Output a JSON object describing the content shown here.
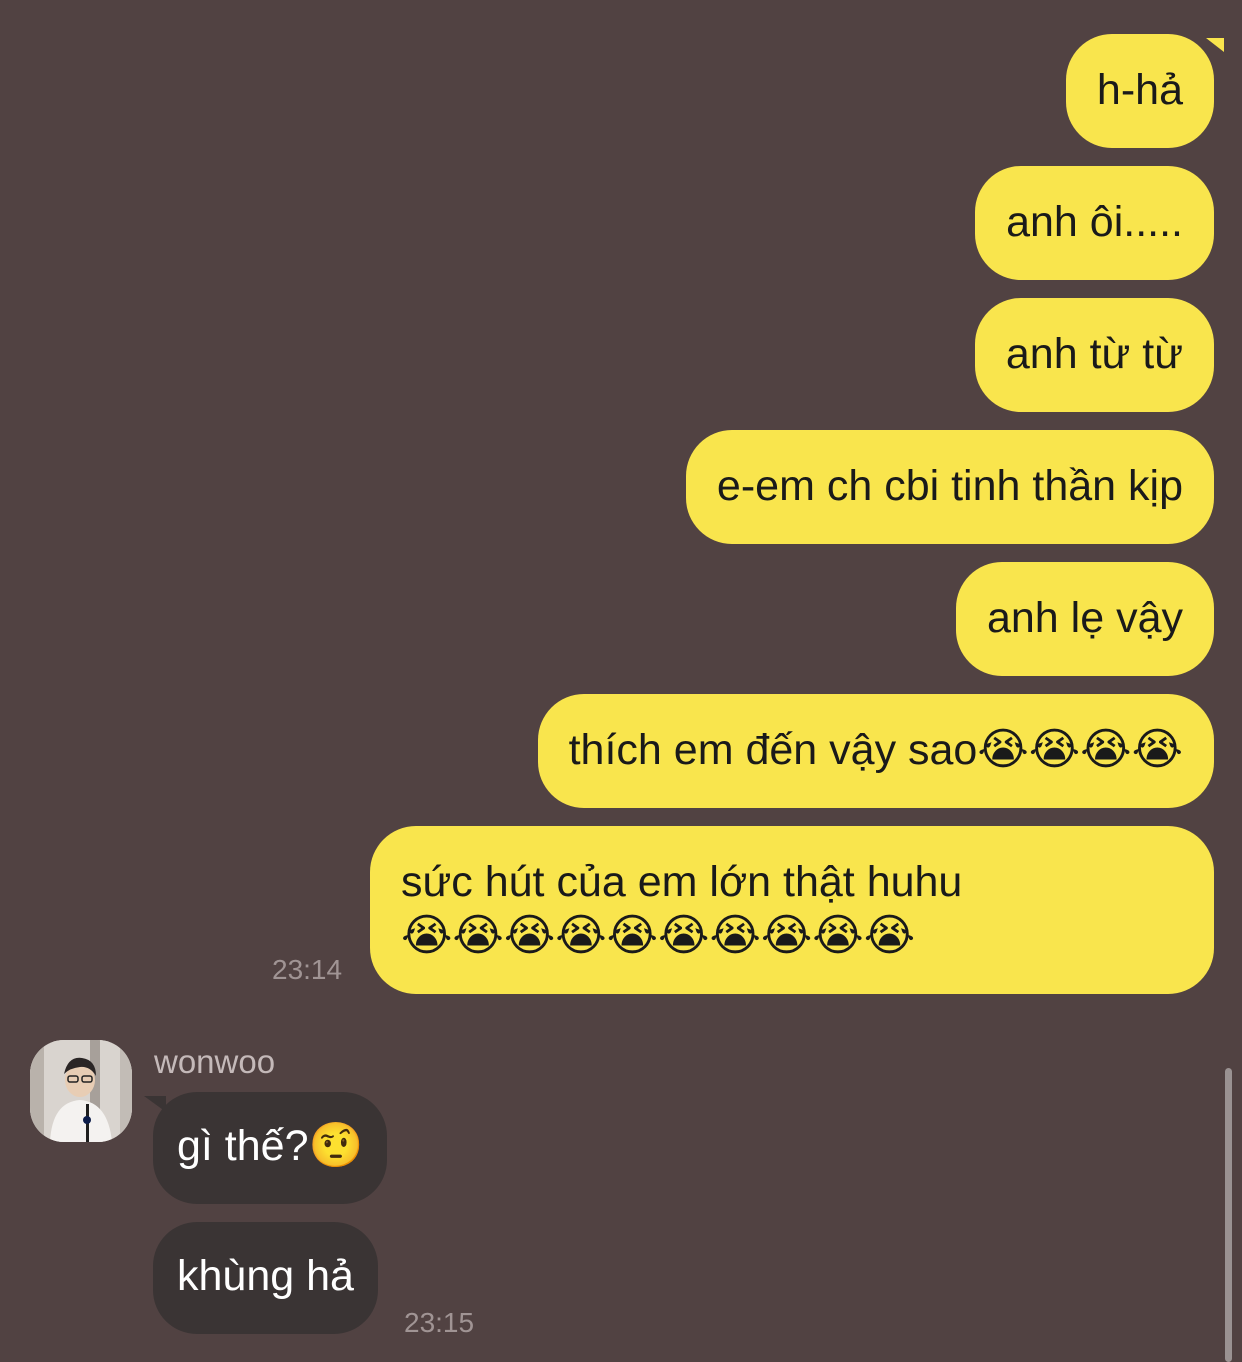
{
  "messages_outgoing": [
    {
      "text": "h-hả"
    },
    {
      "text": "anh ôi....."
    },
    {
      "text": "anh từ từ"
    },
    {
      "text": "e-em ch cbi tinh thần kịp"
    },
    {
      "text": "anh lẹ vậy"
    },
    {
      "text": "thích em đến vậy sao",
      "emoji": "😭😭😭😭"
    },
    {
      "text": "sức hút của em lớn thật huhu",
      "emoji": "😭😭😭😭😭😭😭😭😭😭"
    }
  ],
  "outgoing_timestamp": "23:14",
  "sender": {
    "name": "wonwoo"
  },
  "messages_incoming": [
    {
      "text": "gì thế?",
      "emoji": "🤨"
    },
    {
      "text": "khùng hả"
    }
  ],
  "incoming_timestamp": "23:15",
  "colors": {
    "background": "#514242",
    "outgoing_bubble": "#f9e54d",
    "incoming_bubble": "#3a3434",
    "timestamp": "#a09494"
  }
}
